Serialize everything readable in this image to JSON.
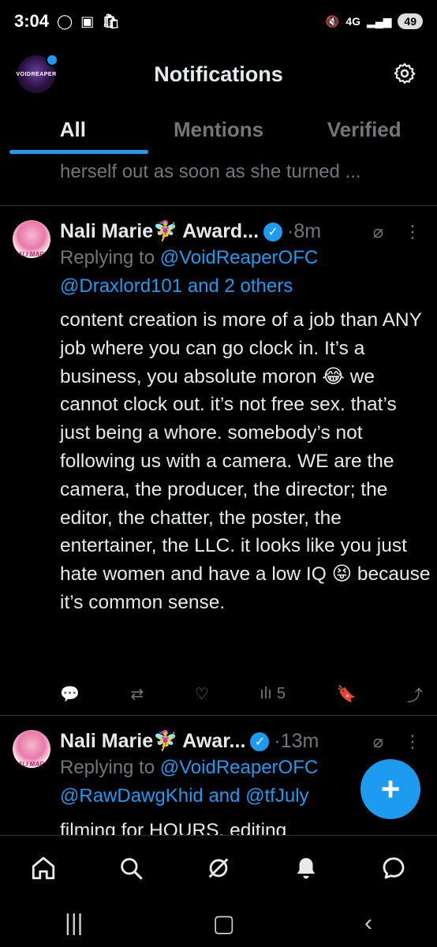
{
  "status": {
    "time": "3:04",
    "network": "4G",
    "battery": "49"
  },
  "header": {
    "avatar_text": "VOIDREAPER",
    "title": "Notifications"
  },
  "tabs": [
    {
      "label": "All",
      "active": true
    },
    {
      "label": "Mentions",
      "active": false
    },
    {
      "label": "Verified",
      "active": false
    }
  ],
  "feed": {
    "prev_text": "herself out as soon as she turned ...",
    "posts": [
      {
        "avatar_text": "NALI MARIE",
        "name": "Nali Marie🧚‍♀️ Award...",
        "time": "·8m",
        "reply_prefix": "Replying to ",
        "reply_user1": "@VoidReaperOFC",
        "reply_user2": "@Draxlord101 and 2 others",
        "body": "content creation is more of a job than ANY job where you can go clock in. It’s a business, you absolute moron 😂 we cannot clock out. it’s not free sex. that’s just being a whore. somebody’s not following us with a camera. WE are the camera, the producer, the director; the editor, the chatter, the poster, the entertainer, the LLC. it looks like you just hate women and have a low IQ 😝 because it’s common sense.",
        "views": "5"
      },
      {
        "avatar_text": "NALI MARIE",
        "name": "Nali Marie🧚‍♀️ Awar...",
        "time": "·13m",
        "reply_prefix": "Replying to ",
        "reply_user1": "@VoidReaperOFC",
        "reply_user2": "@RawDawgKhid and @tfJuly",
        "body": "filming for HOURS, editing"
      }
    ]
  },
  "fab_label": "+",
  "colors": {
    "accent": "#1d9bf0",
    "background": "#000000",
    "muted": "#71767b",
    "text": "#e7e9ea"
  }
}
